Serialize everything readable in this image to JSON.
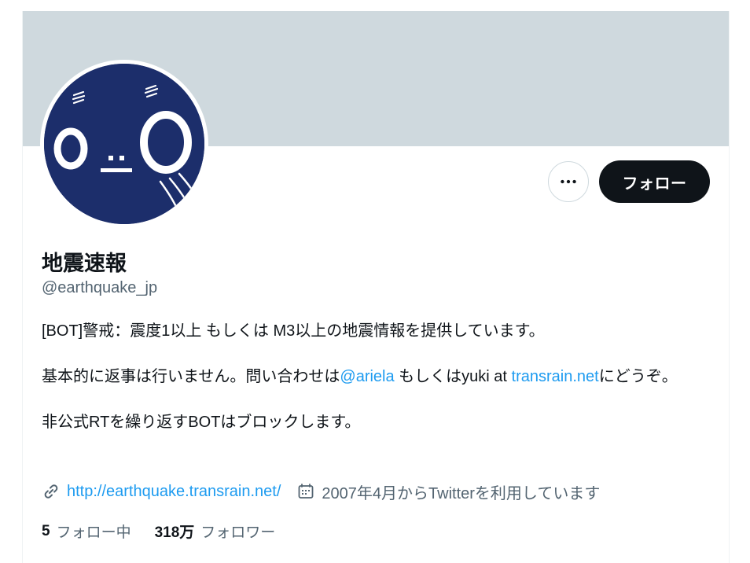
{
  "profile": {
    "display_name": "地震速報",
    "handle": "@earthquake_jp",
    "bio": {
      "line1": "[BOT]警戒：震度1以上 もしくは M3以上の地震情報を提供しています。",
      "line2_prefix": "基本的に返事は行いません。問い合わせは",
      "mention": "@ariela",
      "line2_middle": " もしくはyuki at ",
      "domain_link": "transrain.net",
      "line2_suffix": "にどうぞ。",
      "line3": "非公式RTを繰り返すBOTはブロックします。"
    },
    "website": "http://earthquake.transrain.net/",
    "joined": "2007年4月からTwitterを利用しています",
    "following_count": "5",
    "following_label": "フォロー中",
    "followers_count": "318万",
    "followers_label": "フォロワー"
  },
  "actions": {
    "follow_label": "フォロー",
    "more_icon": "more-horizontal-icon"
  },
  "colors": {
    "banner": "#cfd9de",
    "avatar_bg": "#1c2e6b",
    "link": "#1d9bf0",
    "follow_bg": "#0f1419",
    "secondary_text": "#536471"
  }
}
